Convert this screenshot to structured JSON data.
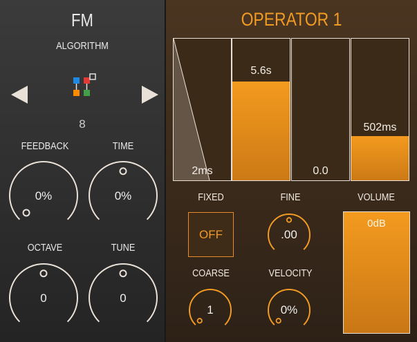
{
  "fm": {
    "title": "FM",
    "algorithm_label": "ALGORITHM",
    "algorithm_number": "8",
    "knobs": [
      {
        "label": "FEEDBACK",
        "value": "0%",
        "level": 0
      },
      {
        "label": "TIME",
        "value": "0%",
        "level": 0.5
      },
      {
        "label": "OCTAVE",
        "value": "0",
        "level": 0.5
      },
      {
        "label": "TUNE",
        "value": "0",
        "level": 0.5
      }
    ]
  },
  "operator": {
    "title": "OPERATOR 1",
    "envelope": [
      {
        "value": "2ms",
        "level": 0
      },
      {
        "value": "5.6s",
        "level": 0.7
      },
      {
        "value": "0.0",
        "level": 0
      },
      {
        "value": "502ms",
        "level": 0.31
      }
    ],
    "fixed_label": "FIXED",
    "fixed_value": "OFF",
    "fine_label": "FINE",
    "fine_value": ".00",
    "coarse_label": "COARSE",
    "coarse_value": "1",
    "velocity_label": "VELOCITY",
    "velocity_value": "0%",
    "volume_label": "VOLUME",
    "volume_value": "0dB"
  },
  "colors": {
    "accent": "#f19a24",
    "text": "#efefef",
    "ring": "#e9e1d8",
    "alg_blue": "#1e88e5",
    "alg_red": "#e53935",
    "alg_orange": "#fb8c00",
    "alg_green": "#43a047"
  }
}
